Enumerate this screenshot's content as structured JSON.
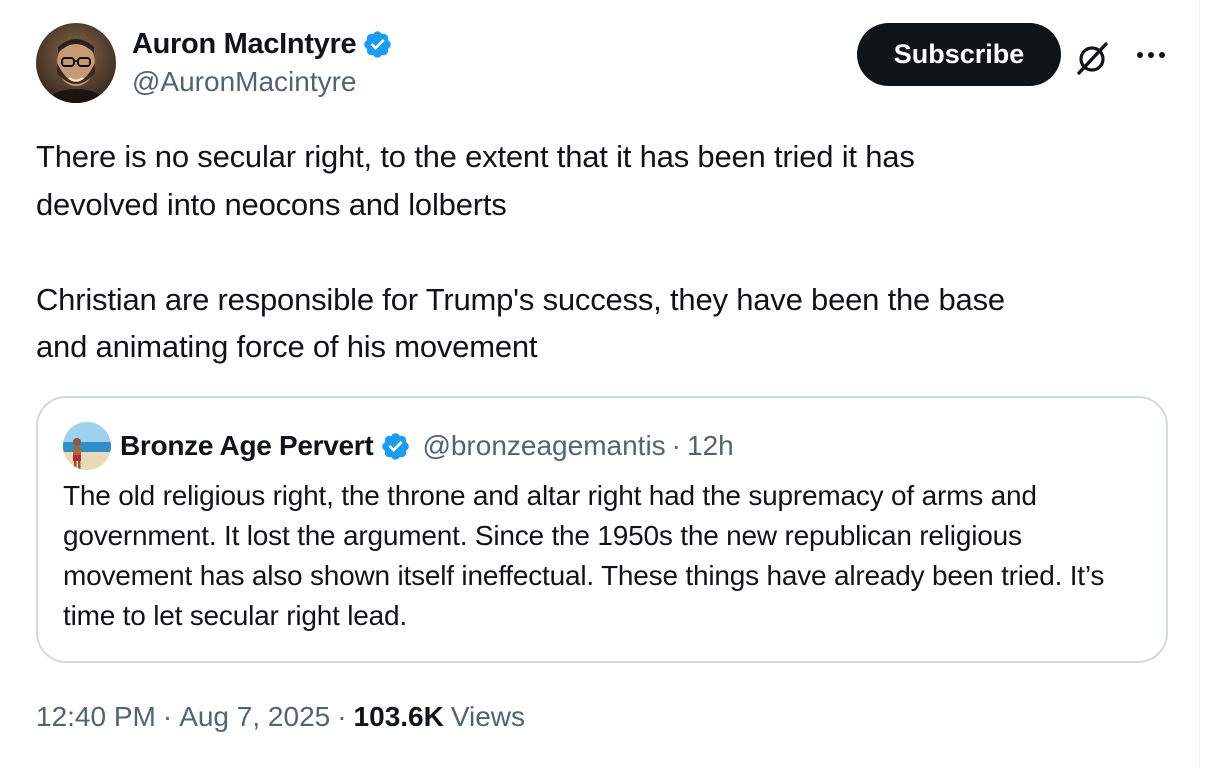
{
  "author": {
    "display_name": "Auron MacIntyre",
    "handle": "@AuronMacintyre",
    "verified": true,
    "avatar_icon": "avatar-bearded-man-glasses"
  },
  "actions": {
    "subscribe_label": "Subscribe",
    "grok_icon": "grok-icon",
    "more_icon": "more-horizontal-icon"
  },
  "tweet": {
    "text": "There is no secular right, to the extent that it has been tried it has\ndevolved into neocons and lolberts\n\nChristian are responsible for Trump's success, they have been the base\nand animating force of his movement"
  },
  "quoted_tweet": {
    "display_name": "Bronze Age Pervert",
    "handle": "@bronzeagemantis",
    "separator": "·",
    "time": "12h",
    "verified": true,
    "avatar_icon": "avatar-beach-man",
    "text": "The old religious right, the throne and altar right had the supremacy of arms and government. It lost the argument. Since the 1950s the new republican religious movement has also shown itself ineffectual. These things have already been tried. It’s time to let secular right lead."
  },
  "meta": {
    "time": "12:40 PM",
    "separator": "·",
    "date": "Aug 7, 2025",
    "views_count": "103.6K",
    "views_label": "Views"
  },
  "colors": {
    "text_primary": "#0f1419",
    "text_secondary": "#536471",
    "verified_blue": "#1d9bf0",
    "border": "#cfd9de",
    "button_bg": "#0f1419"
  }
}
